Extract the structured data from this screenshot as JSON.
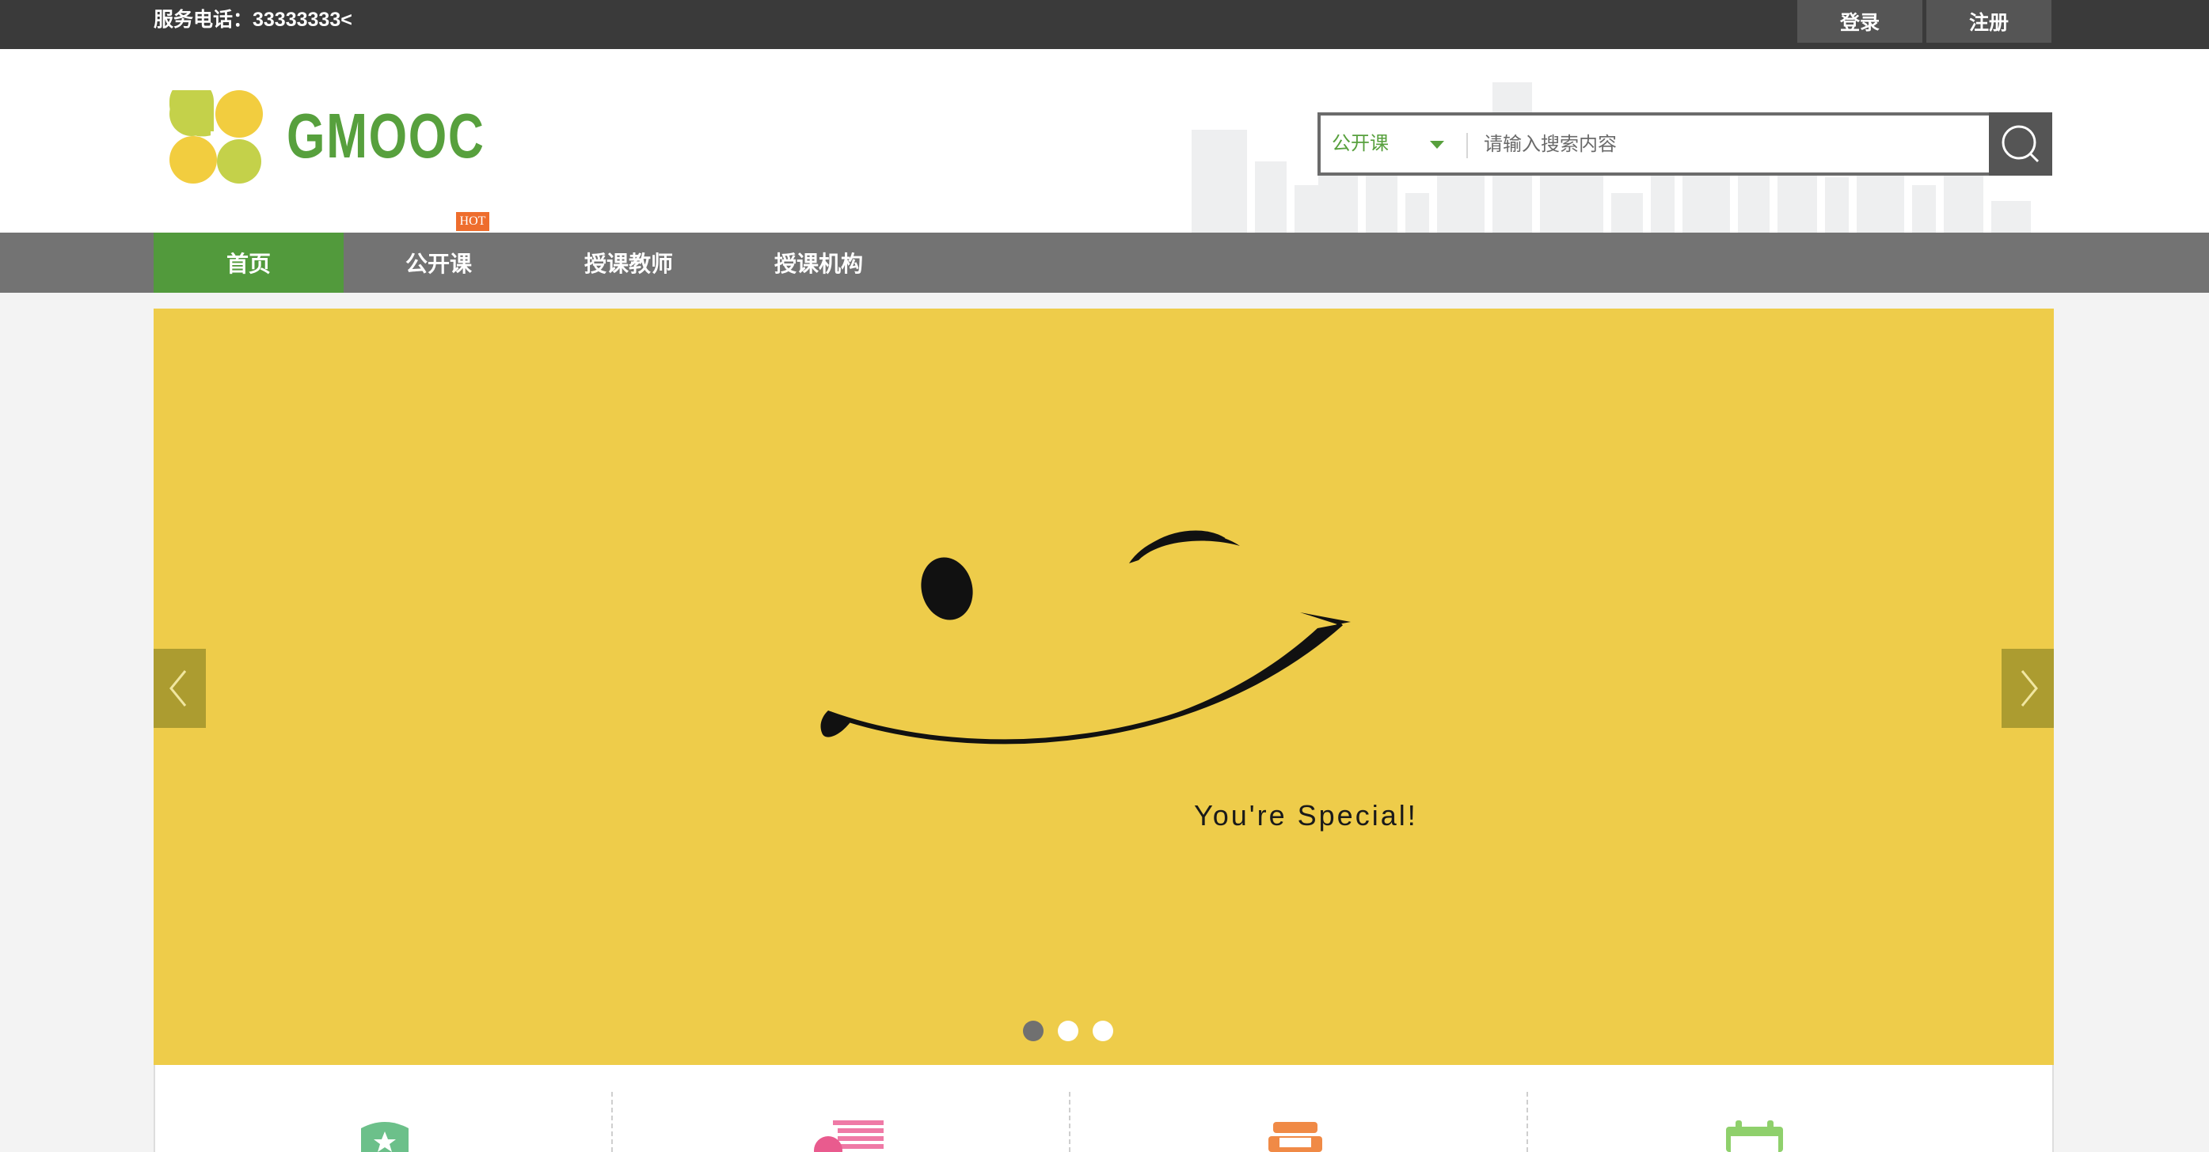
{
  "topbar": {
    "phone": "服务电话：33333333<",
    "login_label": "登录",
    "register_label": "注册"
  },
  "header": {
    "logo_text": "GMOOC",
    "hot_badge": "HOT"
  },
  "search": {
    "category": "公开课",
    "placeholder": "请输入搜索内容",
    "button_icon": "search-icon"
  },
  "nav": {
    "items": [
      {
        "label": "首页",
        "active": true
      },
      {
        "label": "公开课",
        "active": false
      },
      {
        "label": "授课教师",
        "active": false
      },
      {
        "label": "授课机构",
        "active": false
      }
    ]
  },
  "banner": {
    "caption": "You're Special!",
    "slides": 3,
    "active_slide": 1,
    "prev_icon": "chevron-left-icon",
    "next_icon": "chevron-right-icon"
  },
  "features": {
    "icons": [
      "badge-star-icon",
      "list-doc-icon",
      "chair-icon",
      "calendar-icon"
    ]
  },
  "colors": {
    "topbar": "#3a3a3a",
    "brand_green": "#529a3c",
    "nav_bg": "#737373",
    "banner_yellow": "#eecc4a",
    "hot_orange": "#ee6d2d"
  }
}
